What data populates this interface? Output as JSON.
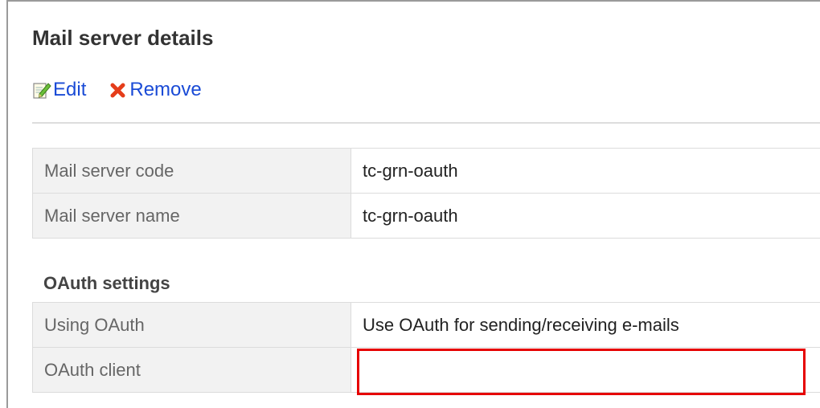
{
  "page": {
    "title": "Mail server details"
  },
  "actions": {
    "edit_label": "Edit",
    "remove_label": "Remove",
    "edit_icon": "edit-icon",
    "remove_icon": "remove-icon",
    "link_color": "#1a4bd6",
    "remove_icon_color": "#e53d1a"
  },
  "basic": {
    "rows": [
      {
        "label": "Mail server code",
        "value": "tc-grn-oauth"
      },
      {
        "label": "Mail server name",
        "value": "tc-grn-oauth"
      }
    ]
  },
  "oauth": {
    "heading": "OAuth settings",
    "rows": [
      {
        "label": "Using OAuth",
        "value": "Use OAuth for sending/receiving e-mails"
      },
      {
        "label": "OAuth client",
        "value": ""
      }
    ]
  },
  "highlight_color": "#e60000"
}
